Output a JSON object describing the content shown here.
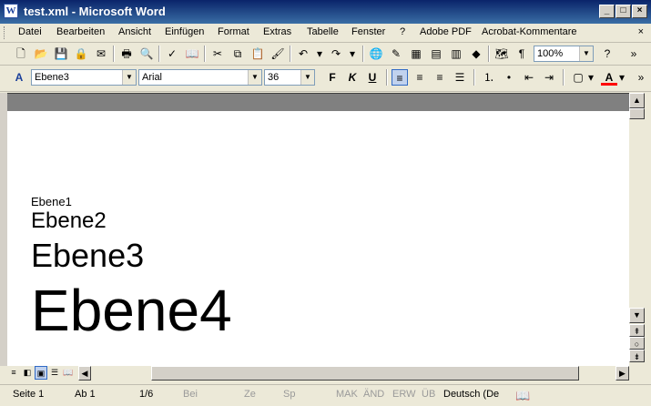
{
  "window": {
    "title": "test.xml - Microsoft Word",
    "app_icon": "W"
  },
  "menu": [
    "Datei",
    "Bearbeiten",
    "Ansicht",
    "Einfügen",
    "Format",
    "Extras",
    "Tabelle",
    "Fenster",
    "?",
    "Adobe PDF",
    "Acrobat-Kommentare"
  ],
  "standard_toolbar": {
    "zoom": "100%"
  },
  "formatting_toolbar": {
    "style": "Ebene3",
    "font": "Arial",
    "size": "36"
  },
  "document": {
    "lines": [
      "Ebene1",
      "Ebene2",
      "Ebene3",
      "Ebene4"
    ]
  },
  "status": {
    "page": "Seite  1",
    "section": "Ab  1",
    "pages": "1/6",
    "at": "Bei",
    "line": "Ze",
    "column": "Sp",
    "mak": "MAK",
    "aend": "ÄND",
    "erw": "ERW",
    "ueb": "ÜB",
    "language": "Deutsch (De"
  },
  "colors": {
    "title_bar": "#0a246a",
    "font_color_underline": "#ff0000"
  }
}
